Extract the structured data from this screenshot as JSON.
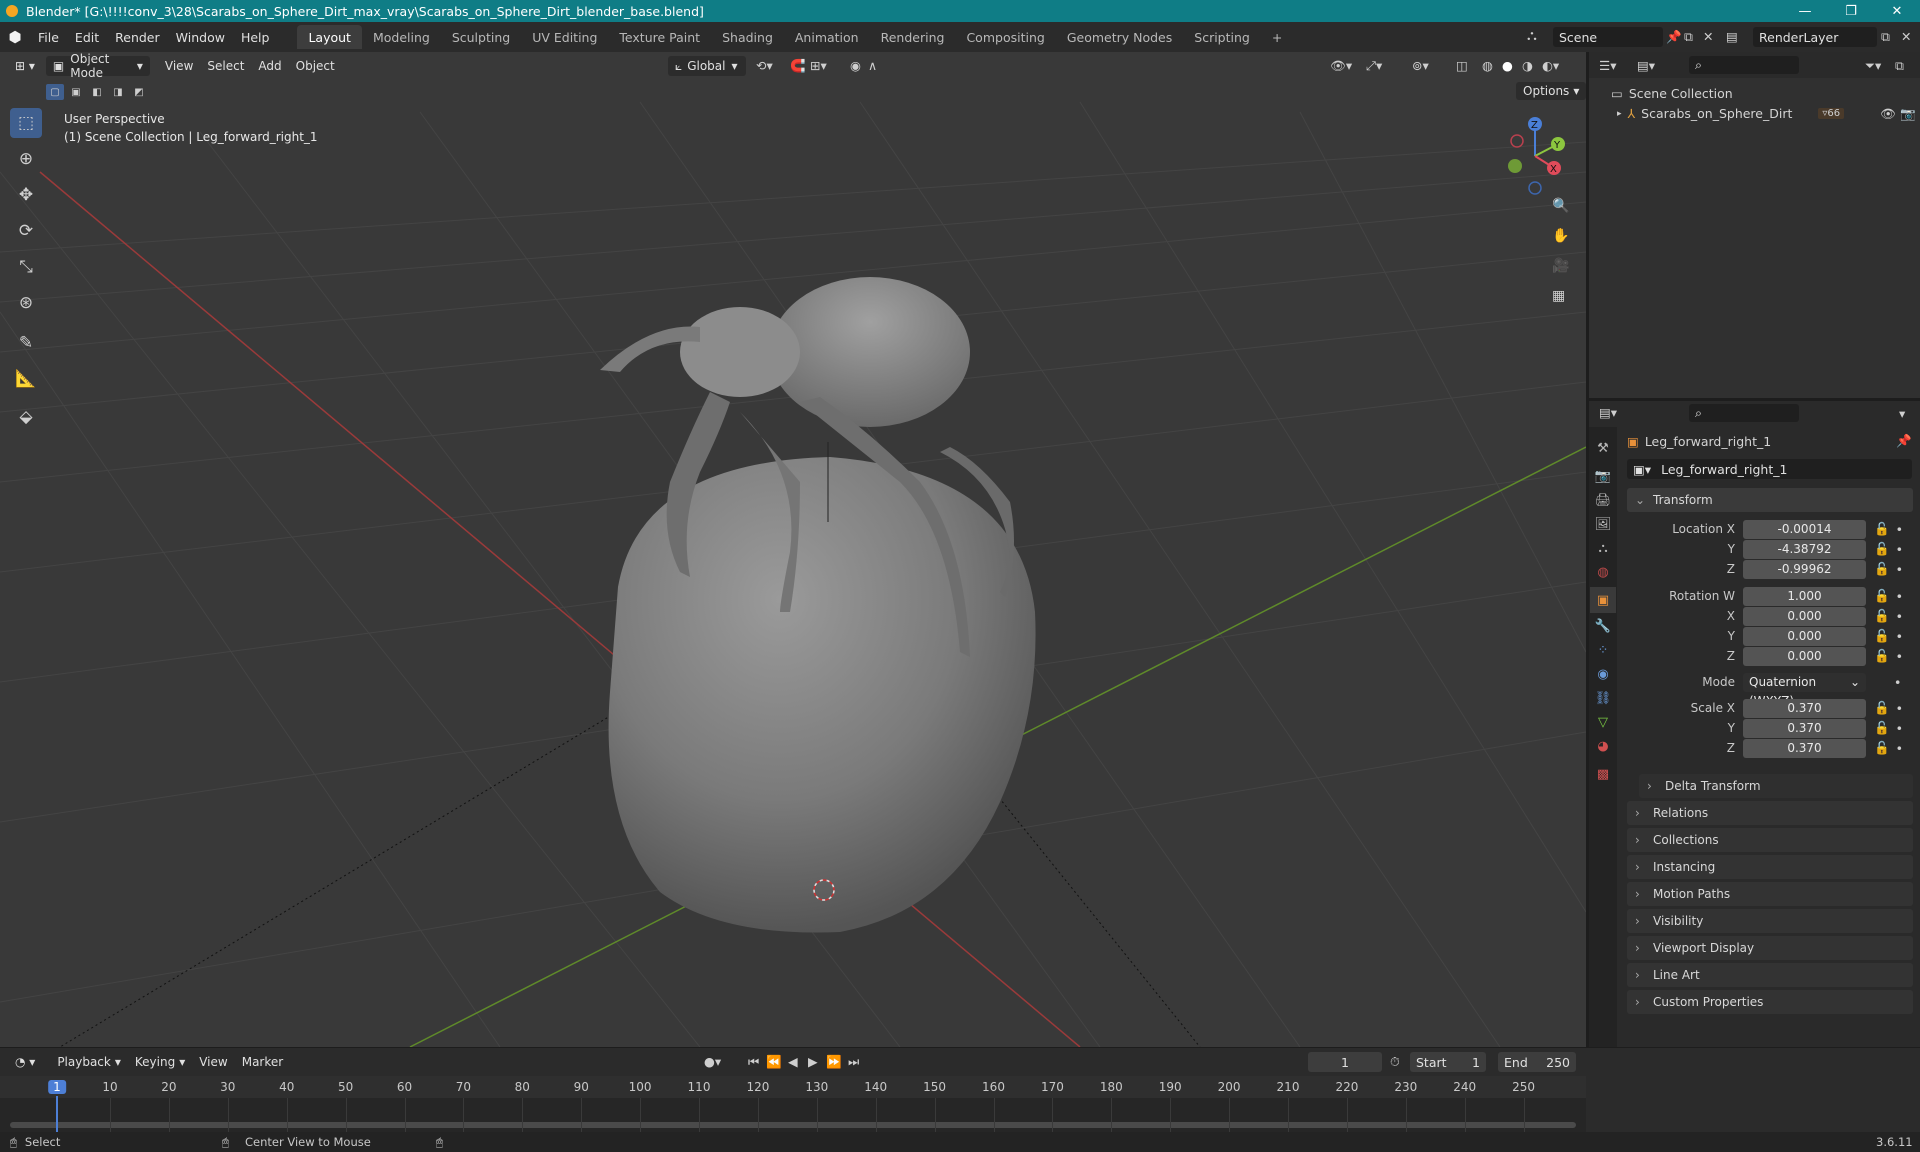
{
  "window": {
    "title": "Blender* [G:\\!!!!conv_3\\28\\Scarabs_on_Sphere_Dirt_max_vray\\Scarabs_on_Sphere_Dirt_blender_base.blend]",
    "minimize": "—",
    "restore": "❐",
    "close": "✕"
  },
  "menu": [
    "File",
    "Edit",
    "Render",
    "Window",
    "Help"
  ],
  "workspaces": [
    "Layout",
    "Modeling",
    "Sculpting",
    "UV Editing",
    "Texture Paint",
    "Shading",
    "Animation",
    "Rendering",
    "Compositing",
    "Geometry Nodes",
    "Scripting"
  ],
  "workspace_add": "+",
  "scene": {
    "name": "Scene",
    "render_layer": "RenderLayer"
  },
  "viewport": {
    "mode": "Object Mode",
    "menus": [
      "View",
      "Select",
      "Add",
      "Object"
    ],
    "orientation": "Global",
    "options_label": "Options",
    "overlay_line1": "User Perspective",
    "overlay_line2": "(1) Scene Collection | Leg_forward_right_1",
    "axes": {
      "x": "X",
      "y": "Y",
      "z": "Z"
    }
  },
  "outliner": {
    "root": "Scene Collection",
    "item": "Scarabs_on_Sphere_Dirt",
    "badge": "66"
  },
  "properties": {
    "object_name": "Leg_forward_right_1",
    "data_name": "Leg_forward_right_1",
    "transform_label": "Transform",
    "rows": [
      {
        "label": "Location X",
        "value": "-0.00014"
      },
      {
        "label": "Y",
        "value": "-4.38792"
      },
      {
        "label": "Z",
        "value": "-0.99962"
      },
      {
        "label": "Rotation W",
        "value": "1.000"
      },
      {
        "label": "X",
        "value": "0.000"
      },
      {
        "label": "Y",
        "value": "0.000"
      },
      {
        "label": "Z",
        "value": "0.000"
      },
      {
        "label": "Mode",
        "value": "Quaternion (WXYZ)"
      },
      {
        "label": "Scale X",
        "value": "0.370"
      },
      {
        "label": "Y",
        "value": "0.370"
      },
      {
        "label": "Z",
        "value": "0.370"
      }
    ],
    "delta_transform": "Delta Transform",
    "panels": [
      "Relations",
      "Collections",
      "Instancing",
      "Motion Paths",
      "Visibility",
      "Viewport Display",
      "Line Art",
      "Custom Properties"
    ]
  },
  "timeline": {
    "menus": [
      "Playback",
      "Keying",
      "View",
      "Marker"
    ],
    "current_frame": "1",
    "start_label": "Start",
    "start": "1",
    "end_label": "End",
    "end": "250",
    "ticks": [
      "1",
      "10",
      "20",
      "30",
      "40",
      "50",
      "60",
      "70",
      "80",
      "90",
      "100",
      "110",
      "120",
      "130",
      "140",
      "150",
      "160",
      "170",
      "180",
      "190",
      "200",
      "210",
      "220",
      "230",
      "240",
      "250"
    ]
  },
  "status": {
    "left": "Select",
    "middle": "Center View to Mouse",
    "version": "3.6.11"
  }
}
